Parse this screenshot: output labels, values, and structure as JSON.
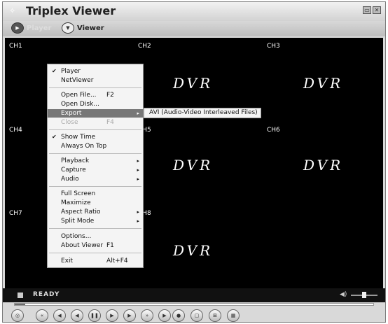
{
  "window": {
    "title": "Triplex Viewer",
    "app_icon": "triplex-app-icon",
    "min_glyph": "▭",
    "close_glyph": "✕"
  },
  "modes": [
    {
      "label": "Player",
      "icon": "play-icon",
      "active": true
    },
    {
      "label": "Viewer",
      "icon": "viewer-icon",
      "active": false
    }
  ],
  "channels": [
    "CH1",
    "CH2",
    "CH3",
    "CH4",
    "CH5",
    "CH6",
    "CH7",
    "CH8"
  ],
  "dvr_text": "DVR",
  "menu": {
    "items": [
      {
        "check": "✔",
        "label": "Player"
      },
      {
        "label": "NetViewer"
      },
      {
        "label": "Open File...",
        "shortcut": "F2"
      },
      {
        "label": "Open Disk..."
      },
      {
        "label": "Export",
        "submenu": "▸",
        "highlighted": true
      },
      {
        "label": "Close",
        "shortcut": "F4",
        "disabled": true
      },
      {
        "check": "✔",
        "label": "Show Time"
      },
      {
        "label": "Always On Top"
      },
      {
        "label": "Playback",
        "submenu": "▸"
      },
      {
        "label": "Capture",
        "submenu": "▸"
      },
      {
        "label": "Audio",
        "submenu": "▸"
      },
      {
        "label": "Full Screen"
      },
      {
        "label": "Maximize"
      },
      {
        "label": "Aspect Ratio",
        "submenu": "▸"
      },
      {
        "label": "Split Mode",
        "submenu": "▸"
      },
      {
        "label": "Options..."
      },
      {
        "label": "About Viewer",
        "shortcut": "F1"
      },
      {
        "label": "Exit",
        "shortcut": "Alt+F4"
      }
    ]
  },
  "submenu": {
    "item": "AVI (Audio-Video Interleaved Files)"
  },
  "status": {
    "text": "READY",
    "volume_icon": "speaker-icon",
    "volume_level": 0.5
  },
  "seek": {
    "progress": 0.03
  },
  "controls": [
    {
      "name": "speed-icon",
      "glyph": "◎"
    },
    {
      "name": "fast-rewind-icon",
      "glyph": "«"
    },
    {
      "name": "rewind-icon",
      "glyph": "◀"
    },
    {
      "name": "step-back-icon",
      "glyph": "◀"
    },
    {
      "name": "pause-icon",
      "glyph": "❚❚"
    },
    {
      "name": "step-forward-icon",
      "glyph": "▶"
    },
    {
      "name": "play-icon",
      "glyph": "▶"
    },
    {
      "name": "fast-forward-icon",
      "glyph": "»"
    },
    {
      "name": "next-icon",
      "glyph": "▶"
    },
    {
      "name": "snapshot-icon",
      "glyph": "●"
    },
    {
      "name": "single-view-icon",
      "glyph": "▢"
    },
    {
      "name": "quad-view-icon",
      "glyph": "⊞"
    },
    {
      "name": "grid-view-icon",
      "glyph": "▦"
    }
  ]
}
